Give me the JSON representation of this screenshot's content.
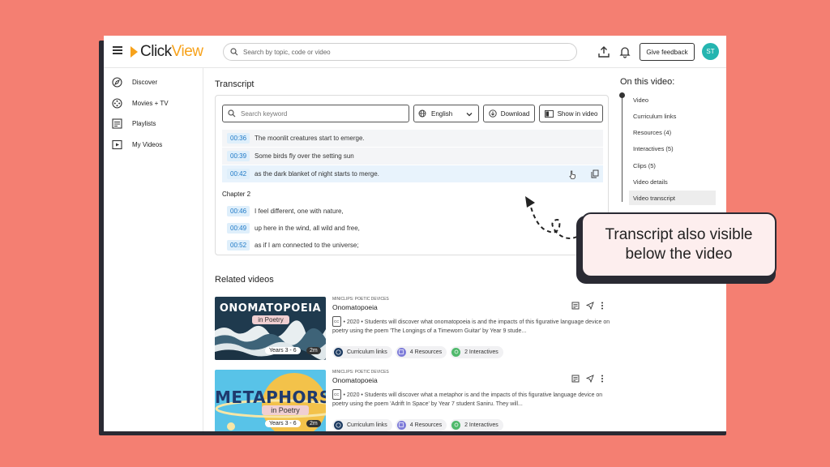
{
  "app": {
    "logo_left": "Click",
    "logo_right": "View"
  },
  "header": {
    "search_placeholder": "Search by topic, code or video",
    "feedback_label": "Give feedback",
    "avatar_initials": "ST"
  },
  "sidebar": {
    "items": [
      {
        "label": "Discover",
        "icon": "compass-icon"
      },
      {
        "label": "Movies + TV",
        "icon": "film-icon"
      },
      {
        "label": "Playlists",
        "icon": "playlist-icon"
      },
      {
        "label": "My Videos",
        "icon": "play-box-icon"
      }
    ]
  },
  "transcript": {
    "title": "Transcript",
    "keyword_placeholder": "Search keyword",
    "language": "English",
    "download_label": "Download",
    "show_in_video_label": "Show in video",
    "lines_a": [
      {
        "time": "00:36",
        "text": "The moonlit creatures start to emerge."
      },
      {
        "time": "00:39",
        "text": "Some birds fly over the setting sun"
      },
      {
        "time": "00:42",
        "text": "as the dark blanket of night starts to merge."
      }
    ],
    "chapter": "Chapter 2",
    "lines_b": [
      {
        "time": "00:46",
        "text": "I feel different, one with nature,"
      },
      {
        "time": "00:49",
        "text": "up here in the wind, all wild and free,"
      },
      {
        "time": "00:52",
        "text": "as if I am connected to the universe;"
      }
    ]
  },
  "related": {
    "title": "Related videos",
    "cards": [
      {
        "thumb_title": "ONOMATOPOEIA",
        "thumb_sub": "in Poetry",
        "years": "Years 3 - 6",
        "duration": "2m",
        "tag": "MINICLIPS: POETIC DEVICES",
        "title": "Onomatopoeia",
        "cc": "CC",
        "desc": "• 2020 • Students will discover what onomatopoeia is and the impacts of this figurative language device on poetry using the poem 'The Longings of a Timeworn Guitar' by Year 9 stude...",
        "meta": [
          "Curriculum links",
          "4 Resources",
          "2 Interactives"
        ]
      },
      {
        "thumb_title": "METAPHORS",
        "thumb_sub": "in Poetry",
        "years": "Years 3 - 6",
        "duration": "2m",
        "tag": "MINICLIPS: POETIC DEVICES",
        "title": "Onomatopoeia",
        "cc": "CC",
        "desc": "• 2020 • Students will discover what a metaphor is and the impacts of this figurative language device on poetry using the poem 'Adrift In Space' by Year 7 student Saniru. They will...",
        "meta": [
          "Curriculum links",
          "4 Resources",
          "2 Interactives"
        ]
      }
    ]
  },
  "on_this_video": {
    "title": "On this video:",
    "items": [
      "Video",
      "Curriculum links",
      "Resources (4)",
      "Interactives (5)",
      "Clips (5)",
      "Video details",
      "Video transcript"
    ]
  },
  "callout": {
    "line1": "Transcript also visible",
    "line2": "below the video"
  },
  "colors": {
    "background": "#f47f72",
    "accent": "#f7a21b",
    "timestamp": "#1d78c6",
    "avatar": "#25b5b0"
  }
}
